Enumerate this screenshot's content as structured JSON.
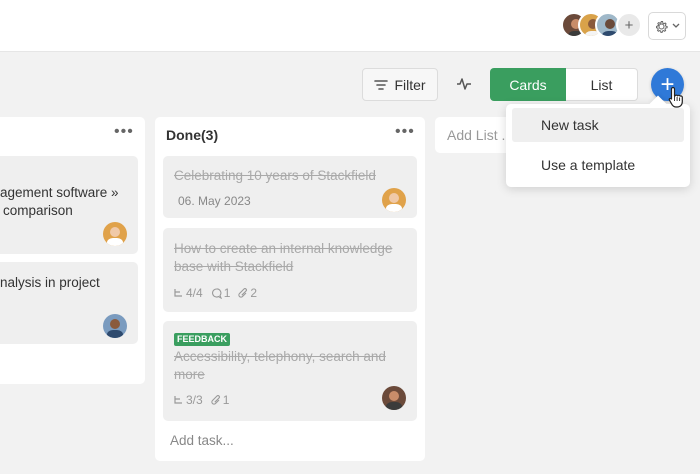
{
  "toolbar": {
    "filter_label": "Filter",
    "view_cards_label": "Cards",
    "view_list_label": "List",
    "add_symbol": "+",
    "add_member_symbol": "+"
  },
  "add_menu": {
    "items": [
      {
        "label": "New task"
      },
      {
        "label": "Use a template"
      }
    ]
  },
  "columns": {
    "left": {
      "cards": [
        {
          "text_line1": "agement software »",
          "text_line2": "comparison"
        },
        {
          "text_line1": "nalysis in project"
        }
      ]
    },
    "done": {
      "title": "Done(3)",
      "cards": [
        {
          "text": "Celebrating 10 years of Stackfield",
          "date": "06. May 2023"
        },
        {
          "text_line1": "How to create an internal knowledge",
          "text_line2": "base with Stackfield",
          "subtasks": "4/4",
          "comments": "1",
          "attachments": "2"
        },
        {
          "badge": "FEEDBACK",
          "text_line1": "Accessibility, telephony, search and",
          "text_line2": "more",
          "subtasks": "3/3",
          "attachments": "1"
        }
      ],
      "add_task_label": "Add task..."
    }
  },
  "add_list_label": "Add List ...",
  "colors": {
    "accent_green": "#3a9e5f",
    "accent_blue": "#2f79d8",
    "background": "#f2f2f2"
  },
  "icons": [
    "filter-icon",
    "activity-icon",
    "gear-icon",
    "chevron-down-icon",
    "plus-icon",
    "subtask-icon",
    "comment-icon",
    "attachment-icon",
    "more-icon",
    "hand-cursor-icon"
  ]
}
